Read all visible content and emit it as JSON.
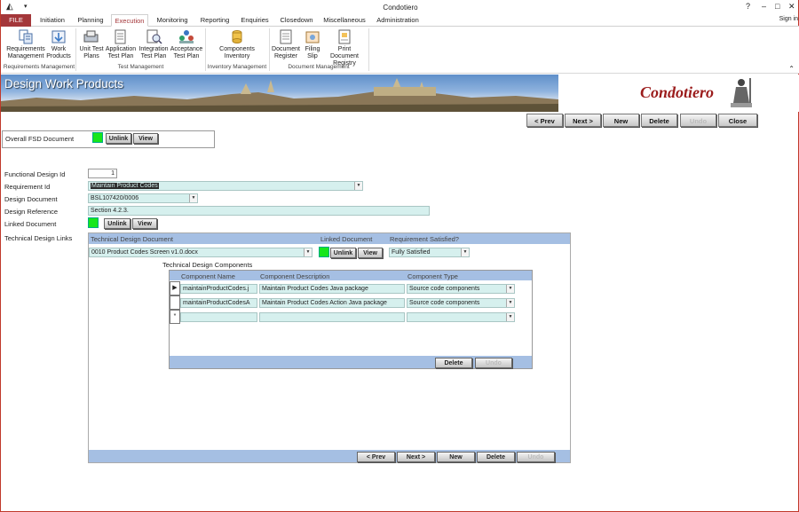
{
  "window": {
    "title": "Condotiero",
    "controls": [
      "?",
      "–",
      "□",
      "✕"
    ]
  },
  "tabs": [
    "FILE",
    "Initiation",
    "Planning",
    "Execution",
    "Monitoring",
    "Reporting",
    "Enquiries",
    "Closedown",
    "Miscellaneous",
    "Administration"
  ],
  "signin": "Sign in",
  "ribbon": {
    "buttons": [
      {
        "label": "Requirements Management",
        "icon": "requirements-icon"
      },
      {
        "label": "Work Products",
        "icon": "work-products-icon"
      },
      {
        "label": "Unit Test Plans",
        "icon": "unit-test-icon"
      },
      {
        "label": "Application Test Plan",
        "icon": "application-test-icon"
      },
      {
        "label": "Integration Test Plan",
        "icon": "integration-test-icon"
      },
      {
        "label": "Acceptance Test Plan",
        "icon": "acceptance-test-icon"
      },
      {
        "label": "Components Inventory",
        "icon": "components-icon"
      },
      {
        "label": "Document Register",
        "icon": "document-register-icon"
      },
      {
        "label": "Filing Slip",
        "icon": "filing-slip-icon"
      },
      {
        "label": "Print Document Registry",
        "icon": "print-registry-icon"
      }
    ],
    "groups": [
      "Requirements Management",
      "Test Management",
      "Inventory Management",
      "Document Management"
    ]
  },
  "banner": {
    "title": "Design Work Products",
    "brand": "Condotiero"
  },
  "nav": {
    "prev": "< Prev",
    "next": "Next >",
    "new": "New",
    "delete": "Delete",
    "undo": "Undo",
    "close": "Close"
  },
  "overall": {
    "label": "Overall FSD Document",
    "unlink": "Unlink",
    "view": "View",
    "status_color": "#17e61b"
  },
  "form": {
    "functional_design_id_label": "Functional Design Id",
    "functional_design_id": "1",
    "requirement_id_label": "Requirement Id",
    "requirement_id": "Maintain Product Codes",
    "design_document_label": "Design Document",
    "design_document": "BSL107420/0006",
    "design_reference_label": "Design Reference",
    "design_reference": "Section 4.2.3.",
    "linked_document_label": "Linked Document",
    "unlink": "Unlink",
    "view": "View",
    "tech_links_label": "Technical Design Links"
  },
  "tech": {
    "col_doc": "Technical Design Document",
    "col_linked": "Linked Document",
    "col_satisfied": "Requirement Satisfied?",
    "doc": "0010 Product Codes Screen v1.0.docx",
    "unlink": "Unlink",
    "view": "View",
    "satisfied": "Fully Satisfied",
    "components_label": "Technical Design Components",
    "comp_headers": [
      "Component Name",
      "Component Description",
      "Component Type"
    ],
    "components": [
      {
        "name": "maintainProductCodes.j",
        "desc": "Maintain Product Codes Java package",
        "type": "Source code components"
      },
      {
        "name": "maintainProductCodesA",
        "desc": "Maintain Product Codes Action Java package",
        "type": "Source code components"
      }
    ],
    "new_row_marker": "*",
    "comp_delete": "Delete",
    "comp_undo": "Undo",
    "nav": {
      "prev": "< Prev",
      "next": "Next >",
      "new": "New",
      "delete": "Delete",
      "undo": "Undo"
    }
  },
  "colors": {
    "file_tab": "#a4373a",
    "active_tab": "#a4373a",
    "field_bg": "#d6f0ee",
    "header_bg": "#a5bfe3",
    "linked": "#17e61b"
  }
}
